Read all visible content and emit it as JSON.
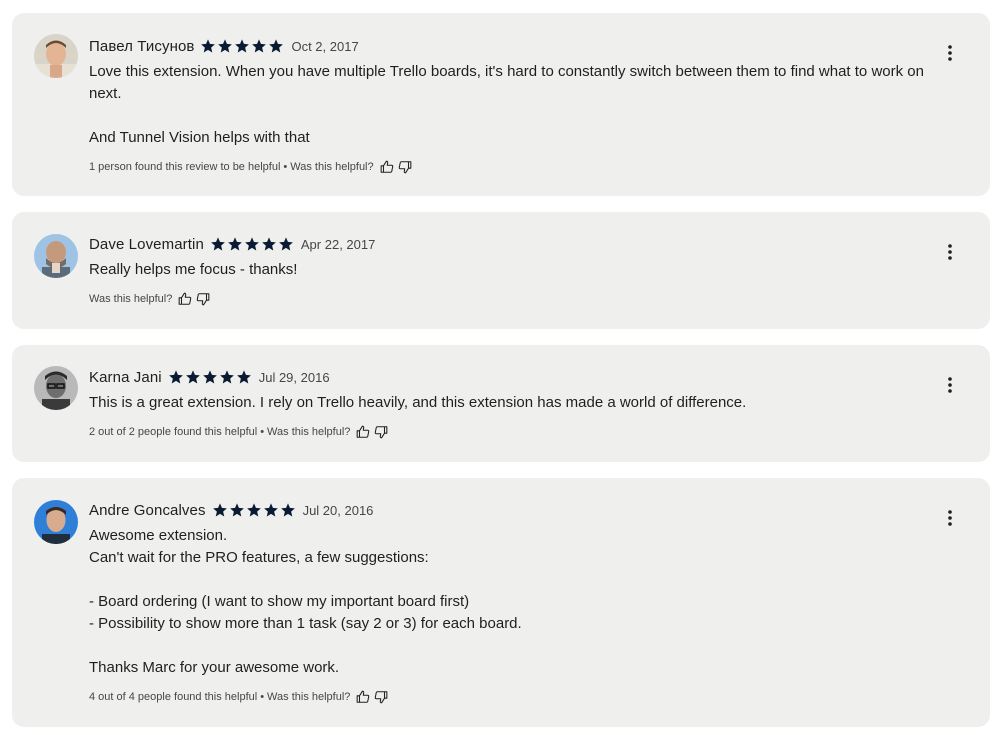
{
  "colors": {
    "card_bg": "#eff0ee",
    "star": "#0b1a33",
    "text": "#1f1f1f",
    "meta": "#444746"
  },
  "icons": {
    "star": "star-icon",
    "thumb_up": "thumbs-up-icon",
    "thumb_down": "thumbs-down-icon",
    "more": "more-vert-icon"
  },
  "reviews": [
    {
      "author": "Павел Тисунов",
      "rating": 5,
      "date": "Oct 2, 2017",
      "text": "Love this extension. When you have multiple Trello boards, it's hard to constantly switch between them to find what to work on next.\n\nAnd Tunnel Vision helps with that",
      "helpful_count": "1 person found this review to be helpful",
      "helpful_separator": "•",
      "helpful_prompt": "Was this helpful?"
    },
    {
      "author": "Dave Lovemartin",
      "rating": 5,
      "date": "Apr 22, 2017",
      "text": "Really helps me focus - thanks!",
      "helpful_count": "",
      "helpful_separator": "",
      "helpful_prompt": "Was this helpful?"
    },
    {
      "author": "Karna Jani",
      "rating": 5,
      "date": "Jul 29, 2016",
      "text": "This is a great extension. I rely on Trello heavily, and this extension has made a world of difference.",
      "helpful_count": "2 out of 2 people found this helpful",
      "helpful_separator": "•",
      "helpful_prompt": "Was this helpful?"
    },
    {
      "author": "Andre Goncalves",
      "rating": 5,
      "date": "Jul 20, 2016",
      "text": "Awesome extension.\nCan't wait for the PRO features, a few suggestions:\n\n- Board ordering (I want to show my important board first)\n- Possibility to show more than 1 task (say 2 or 3) for each board.\n\nThanks Marc for your awesome work.",
      "helpful_count": "4 out of 4 people found this helpful",
      "helpful_separator": "•",
      "helpful_prompt": "Was this helpful?"
    }
  ]
}
